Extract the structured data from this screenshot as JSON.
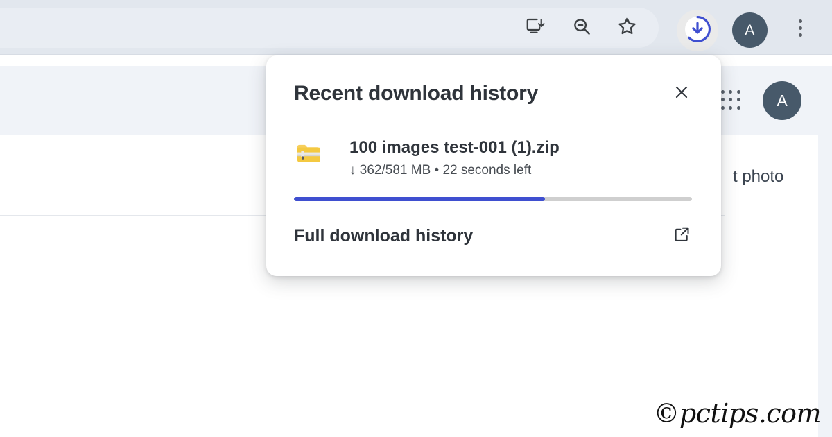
{
  "browser_toolbar": {
    "icons": [
      {
        "name": "install-app-icon",
        "label": "Install app"
      },
      {
        "name": "zoom-out-icon",
        "label": "Zoom out"
      },
      {
        "name": "bookmark-star-icon",
        "label": "Bookmark this tab"
      }
    ],
    "download_button": {
      "label": "Downloads",
      "ring_color": "#3f4fd0",
      "bg_color": "#eaeaea",
      "progress_percent": 63
    },
    "profile_avatar": {
      "initial": "A",
      "bg_color": "#47596a"
    },
    "menu_button": {
      "label": "Customize and control Google Chrome"
    },
    "bg_color": "#e2e7ee"
  },
  "page": {
    "apps_grid_label": "Google apps",
    "account_avatar": {
      "initial": "A",
      "bg_color": "#47596a"
    },
    "partial_text": "t photo",
    "band_color": "#f0f3f8"
  },
  "download_popup": {
    "title": "Recent download history",
    "close_label": "Close",
    "item": {
      "icon": "zip-folder-icon",
      "filename": "100 images test-001 (1).zip",
      "status": "↓ 362/581 MB • 22 seconds left",
      "downloaded_mb": 362,
      "total_mb": 581,
      "time_left": "22 seconds left",
      "progress_percent": 63,
      "progress_color": "#3f4fd0",
      "track_color": "#cfcfcf"
    },
    "footer": {
      "label": "Full download history",
      "icon": "open-in-new-icon"
    }
  },
  "watermark": {
    "text": "©pctips.com"
  }
}
